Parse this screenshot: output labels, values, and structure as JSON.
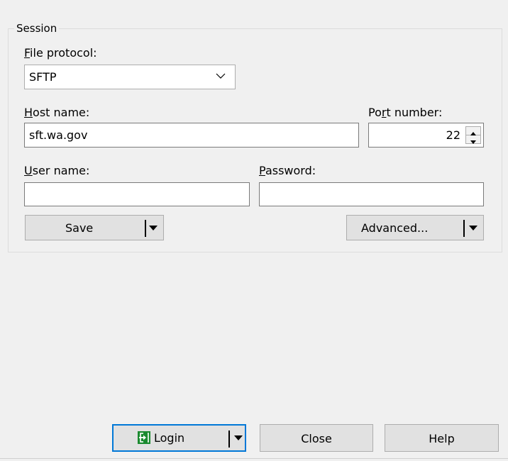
{
  "session": {
    "group_title": "Session",
    "file_protocol_label": "File protocol:",
    "file_protocol_value": "SFTP",
    "host_name_label": "Host name:",
    "host_name_value": "sft.wa.gov",
    "port_number_label": "Port number:",
    "port_number_value": "22",
    "user_name_label": "User name:",
    "user_name_value": "",
    "password_label": "Password:",
    "password_value": "",
    "save_label": "Save",
    "advanced_label": "Advanced..."
  },
  "footer": {
    "login_label": "Login",
    "close_label": "Close",
    "help_label": "Help"
  },
  "icons": {
    "dropdown": "chevron-down-icon",
    "split_dropdown": "caret-down-icon",
    "spinner": "spinner-arrows-icon",
    "login": "login-icon"
  },
  "colors": {
    "window_background": "#f0f0f0",
    "default_button_border": "#0078d7",
    "login_icon": "#1b8a2f"
  }
}
